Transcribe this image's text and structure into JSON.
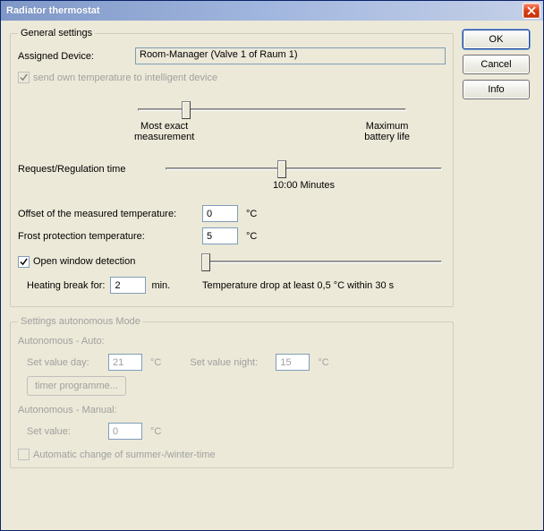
{
  "window": {
    "title": "Radiator thermostat"
  },
  "buttons": {
    "ok": "OK",
    "cancel": "Cancel",
    "info": "Info",
    "timer_programme": "timer programme..."
  },
  "general": {
    "legend": "General settings",
    "assigned_device_label": "Assigned Device:",
    "assigned_device_value": "Room-Manager  (Valve 1 of Raum 1)",
    "send_own_temp_label": "send own temperature to intelligent device",
    "send_own_temp_checked": true,
    "slider1": {
      "value_percent": 18,
      "left_label": "Most exact\nmeasurement",
      "right_label": "Maximum\nbattery life"
    },
    "request_time_label": "Request/Regulation time",
    "request_time_slider_percent": 42,
    "request_time_value": "10:00 Minutes",
    "offset_label": "Offset of the measured temperature:",
    "offset_value": "0",
    "frost_label": "Frost protection temperature:",
    "frost_value": "5",
    "unit_c": "°C",
    "open_window_label": "Open window detection",
    "open_window_checked": true,
    "open_window_slider_percent": 0,
    "heating_break_label": "Heating break for:",
    "heating_break_value": "2",
    "heating_break_unit": "min.",
    "temp_drop_hint": "Temperature drop at least 0,5 °C within 30 s"
  },
  "autonomous": {
    "legend": "Settings autonomous Mode",
    "auto_label": "Autonomous - Auto:",
    "set_day_label": "Set value day:",
    "set_day_value": "21",
    "set_night_label": "Set value night:",
    "set_night_value": "15",
    "manual_label": "Autonomous - Manual:",
    "set_value_label": "Set value:",
    "set_value_value": "0",
    "summer_winter_label": "Automatic change of summer-/winter-time",
    "summer_winter_checked": false,
    "unit_c": "°C"
  }
}
